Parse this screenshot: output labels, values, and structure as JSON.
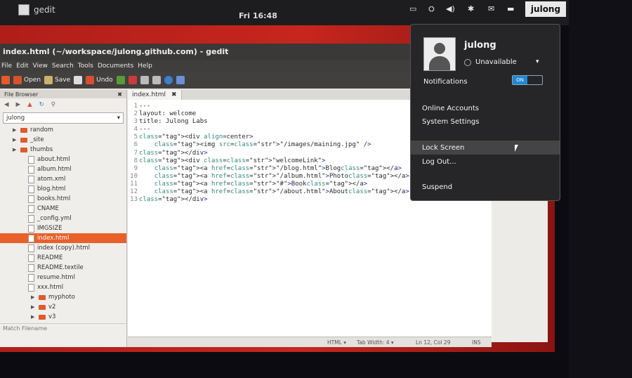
{
  "panel": {
    "app_name": "gedit",
    "clock": "Fri 16:48",
    "indicators": [
      "▭",
      "⛭",
      "◀)",
      "✱",
      "✉",
      "▬"
    ],
    "user": "julong"
  },
  "window": {
    "title": "index.html (~/workspace/julong.github.com) - gedit",
    "menu": [
      "File",
      "Edit",
      "View",
      "Search",
      "Tools",
      "Documents",
      "Help"
    ],
    "toolbar": {
      "open": "Open",
      "save": "Save",
      "undo": "Undo"
    }
  },
  "sidebar": {
    "title": "File Browser",
    "location": "julong",
    "items": [
      {
        "name": "random",
        "type": "folder"
      },
      {
        "name": "_site",
        "type": "folder"
      },
      {
        "name": "thumbs",
        "type": "folder"
      },
      {
        "name": "about.html",
        "type": "file"
      },
      {
        "name": "album.html",
        "type": "file"
      },
      {
        "name": "atom.xml",
        "type": "file"
      },
      {
        "name": "blog.html",
        "type": "file"
      },
      {
        "name": "books.html",
        "type": "file"
      },
      {
        "name": "CNAME",
        "type": "file"
      },
      {
        "name": "_config.yml",
        "type": "file"
      },
      {
        "name": "IMGSIZE",
        "type": "file"
      },
      {
        "name": "index.html",
        "type": "file"
      },
      {
        "name": "index (copy).html",
        "type": "file"
      },
      {
        "name": "README",
        "type": "file"
      },
      {
        "name": "README.textile",
        "type": "file"
      },
      {
        "name": "resume.html",
        "type": "file"
      },
      {
        "name": "xxx.html",
        "type": "file"
      },
      {
        "name": "myphoto",
        "type": "folder"
      },
      {
        "name": "v2",
        "type": "folder"
      },
      {
        "name": "v3",
        "type": "folder"
      }
    ],
    "filter_label": "Match Filename"
  },
  "editor": {
    "tab": "index.html",
    "lines": [
      "---",
      "layout: welcome",
      "title: Julong Labs",
      "---",
      "<div align=center>",
      "    <img src=\"/images/maining.jpg\" />",
      "</div>",
      "<div class=\"welcomeLink\">",
      "    <a href=\"/blog.html\">Blog</a>",
      "    <a href=\"/album.html\">Photo</a>",
      "    <a href=\"#\">Book</a>",
      "    <a href=\"/about.html\">About</a>",
      "</div>"
    ],
    "status": {
      "lang": "HTML ▾",
      "tab_width": "Tab Width: 4 ▾",
      "position": "Ln 12, Col 29",
      "mode": "INS"
    }
  },
  "user_menu": {
    "name": "julong",
    "availability": "Unavailable",
    "notifications_label": "Notifications",
    "switch_on": "ON",
    "items": [
      "Online Accounts",
      "System Settings",
      "Lock Screen",
      "Log Out...",
      "Suspend"
    ]
  }
}
